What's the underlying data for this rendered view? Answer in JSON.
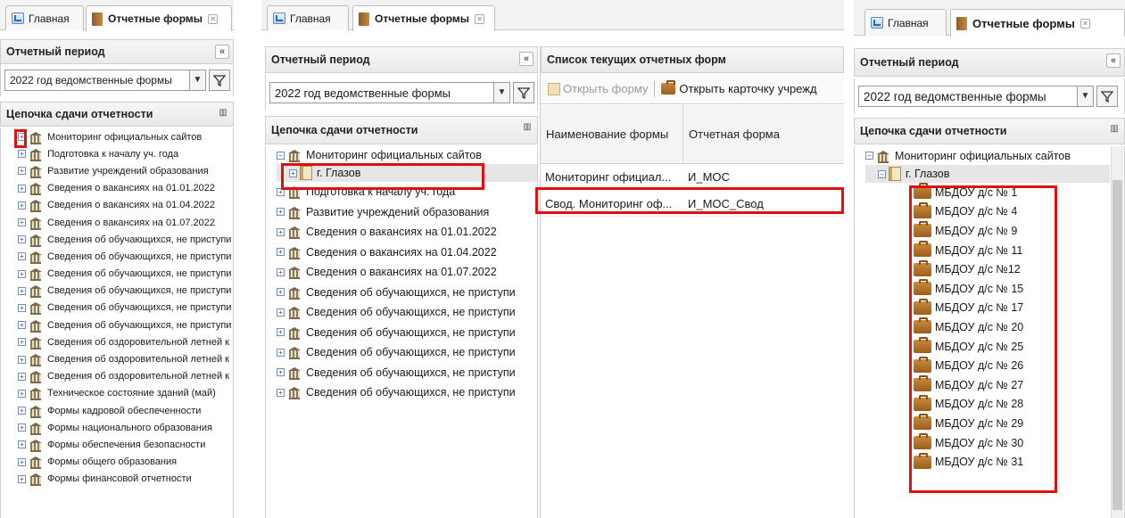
{
  "tabs": {
    "home": "Главная",
    "forms": "Отчетные формы"
  },
  "period": {
    "title": "Отчетный период",
    "value": "2022 год ведомственные формы"
  },
  "chain": {
    "title": "Цепочка сдачи отчетности",
    "items_left": [
      "Мониторинг официальных сайтов",
      "Подготовка к началу уч. года",
      "Развитие учреждений образования",
      "Сведения о вакансиях на 01.01.2022",
      "Сведения о вакансиях на 01.04.2022",
      "Сведения о вакансиях на 01.07.2022",
      "Сведения об обучающихся, не приступи",
      "Сведения об обучающихся, не приступи",
      "Сведения об обучающихся, не приступи",
      "Сведения об обучающихся, не приступи",
      "Сведения об обучающихся, не приступи",
      "Сведения об обучающихся, не приступи",
      "Сведения об оздоровительной летней к",
      "Сведения об оздоровительной летней к",
      "Сведения об оздоровительной летней к",
      "Техническое состояние зданий (май)",
      "Формы кадровой обеспеченности",
      "Формы национального образования",
      "Формы обеспечения безопасности",
      "Формы общего образования",
      "Формы финансовой отчетности"
    ],
    "items_mid": {
      "root": "Мониторинг официальных сайтов",
      "child": "г. Глазов",
      "rest": [
        "Подготовка к началу уч. года",
        "Развитие учреждений образования",
        "Сведения о вакансиях на 01.01.2022",
        "Сведения о вакансиях на 01.04.2022",
        "Сведения о вакансиях на 01.07.2022",
        "Сведения об обучающихся, не приступи",
        "Сведения об обучающихся, не приступи",
        "Сведения об обучающихся, не приступи",
        "Сведения об обучающихся, не приступи",
        "Сведения об обучающихся, не приступи",
        "Сведения об обучающихся, не приступи"
      ]
    },
    "items_right": {
      "root": "Мониторинг официальных сайтов",
      "child": "г. Глазов",
      "schools": [
        "МБДОУ д/с № 1",
        "МБДОУ д/с № 4",
        "МБДОУ д/с № 9",
        "МБДОУ д/с № 11",
        "МБДОУ д/с №12",
        "МБДОУ д/с № 15",
        "МБДОУ д/с № 17",
        "МБДОУ д/с № 20",
        "МБДОУ д/с № 25",
        "МБДОУ д/с № 26",
        "МБДОУ д/с № 27",
        "МБДОУ д/с № 28",
        "МБДОУ д/с № 29",
        "МБДОУ д/с № 30",
        "МБДОУ д/с № 31"
      ]
    }
  },
  "forms_list": {
    "title": "Список текущих отчетных форм",
    "open_form": "Открыть форму",
    "open_card": "Открыть карточку учрежд",
    "col_name": "Наименование формы",
    "col_form": "Отчетная форма",
    "rows": [
      {
        "name": "Мониторинг официал...",
        "form": "И_МОС"
      },
      {
        "name": "Свод. Мониторинг оф...",
        "form": "И_МОС_Свод"
      }
    ]
  },
  "colors": {
    "highlight": "#e01010",
    "selected_row": "#e6e6e6"
  }
}
